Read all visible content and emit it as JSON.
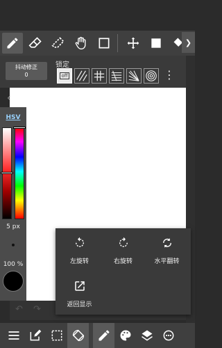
{
  "stabilizer": {
    "label": "抖动修正",
    "value": "0"
  },
  "lock": {
    "label": "锁定",
    "off_label": "off"
  },
  "color_panel": {
    "mode": "HSV",
    "brush_size": "5 px",
    "opacity": "100 %"
  },
  "popup": {
    "rotate_left": "左旋转",
    "rotate_right": "右旋转",
    "flip_horizontal": "水平翻转",
    "reset_display": "返回显示"
  },
  "colors": {
    "background": "#2b2b2b",
    "toolbar": "#3f3f3f",
    "canvas": "#ffffff",
    "popup": "#3a3a3a",
    "accent": "#9ad3ff"
  }
}
